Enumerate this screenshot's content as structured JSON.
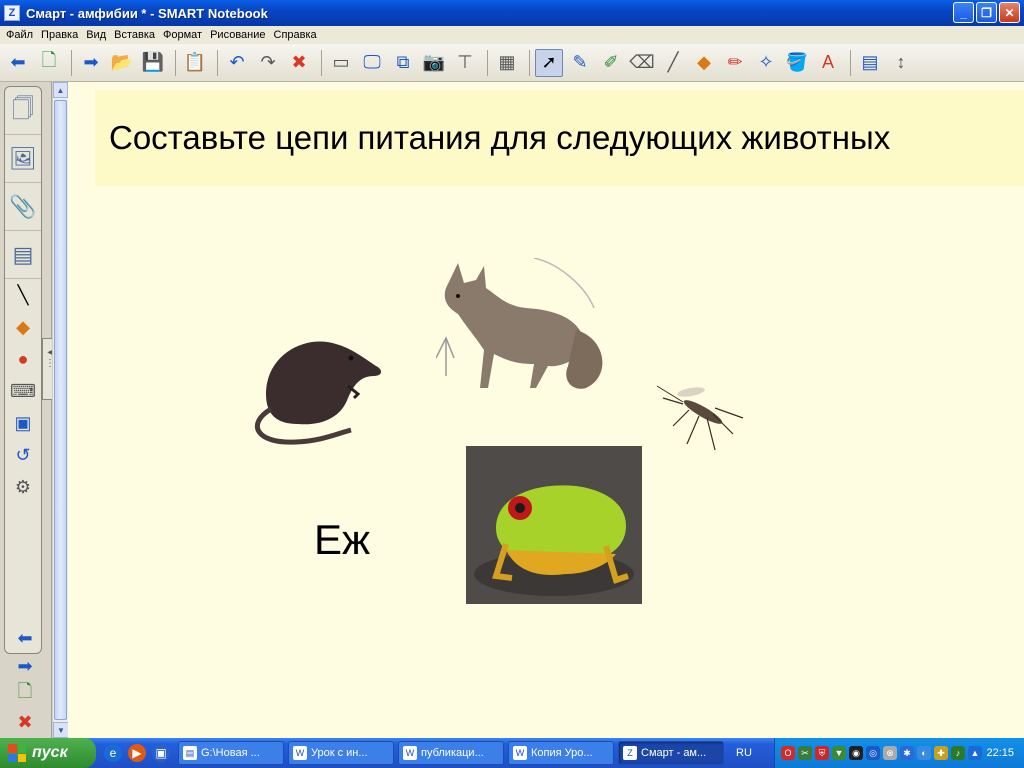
{
  "window": {
    "title": "Смарт - амфибии * - SMART Notebook",
    "app_icon": "notebook-icon",
    "controls": [
      "minimize",
      "maximize",
      "close"
    ]
  },
  "menu": [
    "Файл",
    "Правка",
    "Вид",
    "Вставка",
    "Формат",
    "Рисование",
    "Справка"
  ],
  "toolbar": {
    "icons": [
      "back-arrow-icon",
      "new-page-icon",
      "forward-arrow-icon",
      "open-folder-icon",
      "save-icon",
      "paste-icon",
      "undo-icon",
      "redo-icon",
      "delete-icon",
      "screen-shade-icon",
      "full-screen-icon",
      "dual-screen-icon",
      "screen-capture-icon",
      "document-camera-icon",
      "table-icon",
      "select-icon",
      "pen-icon",
      "creative-pen-icon",
      "eraser-icon",
      "line-icon",
      "shapes-icon",
      "magic-pen-icon",
      "shape-pen-icon",
      "fill-icon",
      "text-icon",
      "properties-icon",
      "move-toolbar-icon"
    ],
    "selected": "select-icon"
  },
  "sidebar": {
    "tabs": [
      "page-sorter-tab",
      "gallery-tab",
      "attachments-tab",
      "properties-tab"
    ],
    "tools": [
      "line-tool-icon",
      "shapes-tool-icon",
      "highlighter-icon",
      "keyboard-icon",
      "notebook-icon",
      "undo-icon",
      "settings-icon"
    ],
    "nav": [
      "previous-page-icon",
      "next-page-icon",
      "add-page-icon",
      "delete-page-icon"
    ]
  },
  "slide": {
    "title": "Составьте цепи питания для следующих животных",
    "animals": [
      "shrew-image",
      "fox-image",
      "mosquito-image",
      "frog-image"
    ],
    "hedgehog_label": "Еж"
  },
  "taskbar": {
    "start_label": "пуск",
    "tasks": [
      {
        "label": "G:\\Новая ...",
        "active": false
      },
      {
        "label": "Урок с ин...",
        "active": false
      },
      {
        "label": "публикаци...",
        "active": false
      },
      {
        "label": "Копия Уро...",
        "active": false
      },
      {
        "label": "Смарт - ам...",
        "active": true
      }
    ],
    "language": "RU",
    "clock": "22:15"
  }
}
